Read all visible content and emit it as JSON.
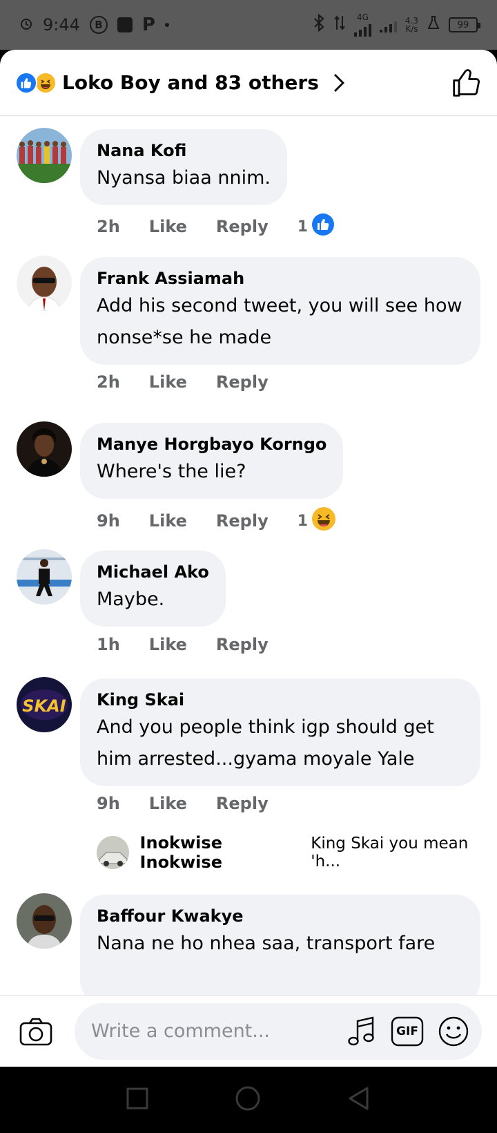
{
  "status_bar": {
    "time": "9:44",
    "network": "4G",
    "speed_value": "4.3",
    "speed_unit": "K/s",
    "battery": "99"
  },
  "header": {
    "reactions_summary": "Loko Boy and 83 others"
  },
  "comments": [
    {
      "author": "Nana Kofi",
      "text": "Nyansa biaa nnim.",
      "time": "2h",
      "like_label": "Like",
      "reply_label": "Reply",
      "reaction_count": "1",
      "reaction": "like"
    },
    {
      "author": "Frank Assiamah",
      "text": "Add his second tweet, you will see how nonse*se he made",
      "time": "2h",
      "like_label": "Like",
      "reply_label": "Reply"
    },
    {
      "author": "Manye Horgbayo Korngo",
      "text": "Where's the lie?",
      "time": "9h",
      "like_label": "Like",
      "reply_label": "Reply",
      "reaction_count": "1",
      "reaction": "haha"
    },
    {
      "author": "Michael Ako",
      "text": "Maybe.",
      "time": "1h",
      "like_label": "Like",
      "reply_label": "Reply"
    },
    {
      "author": "King Skai",
      "text": "And you people think igp should get him arrested...gyama moyale Yale",
      "time": "9h",
      "like_label": "Like",
      "reply_label": "Reply",
      "reply_preview": {
        "author": "Inokwise Inokwise",
        "text": "King Skai you mean 'h..."
      }
    },
    {
      "author": "Baffour Kwakye",
      "text": "Nana ne ho nhea saa, transport fare"
    }
  ],
  "composer": {
    "placeholder": "Write a comment...",
    "gif_label": "GIF"
  },
  "colors": {
    "accent": "#1877f2",
    "haha": "#f7b928",
    "bubble": "#f0f2f5",
    "meta_text": "#65676b"
  }
}
